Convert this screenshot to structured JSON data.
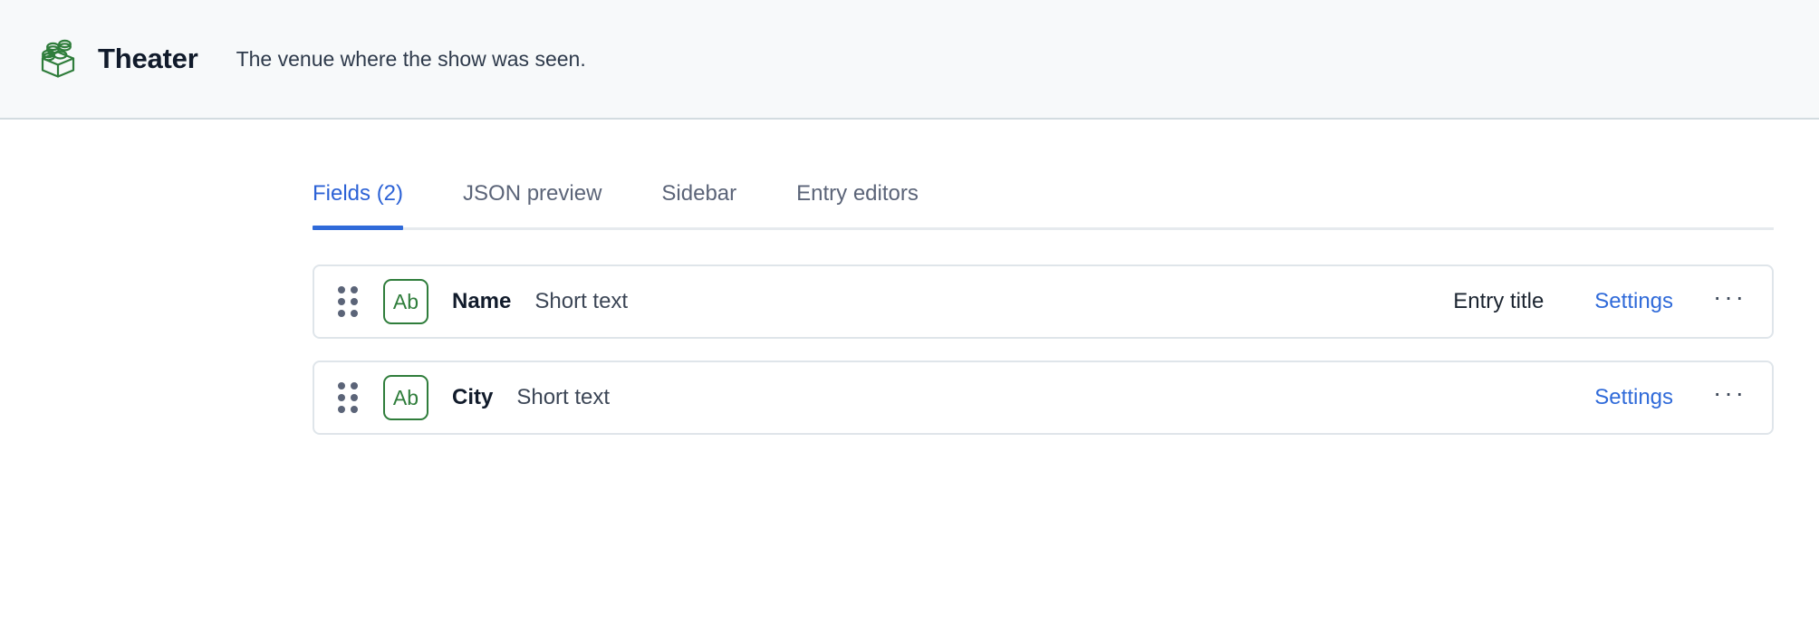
{
  "header": {
    "icon": "content-type-block-icon",
    "title": "Theater",
    "description": "The venue where the show was seen.",
    "icon_color": "#2f7d3b",
    "background": "#f7f9fa"
  },
  "tabs": {
    "active_index": 0,
    "items": [
      {
        "label": "Fields (2)"
      },
      {
        "label": "JSON preview"
      },
      {
        "label": "Sidebar"
      },
      {
        "label": "Entry editors"
      }
    ],
    "active_color": "#2f6ad9",
    "inactive_color": "#5b6478"
  },
  "fields": {
    "rows": [
      {
        "drag_handle": "drag-handle-icon",
        "type_badge": "Ab",
        "name": "Name",
        "type": "Short text",
        "entry_title_tag": "Entry title",
        "settings_label": "Settings",
        "more_label": "···"
      },
      {
        "drag_handle": "drag-handle-icon",
        "type_badge": "Ab",
        "name": "City",
        "type": "Short text",
        "entry_title_tag": "",
        "settings_label": "Settings",
        "more_label": "···"
      }
    ]
  }
}
